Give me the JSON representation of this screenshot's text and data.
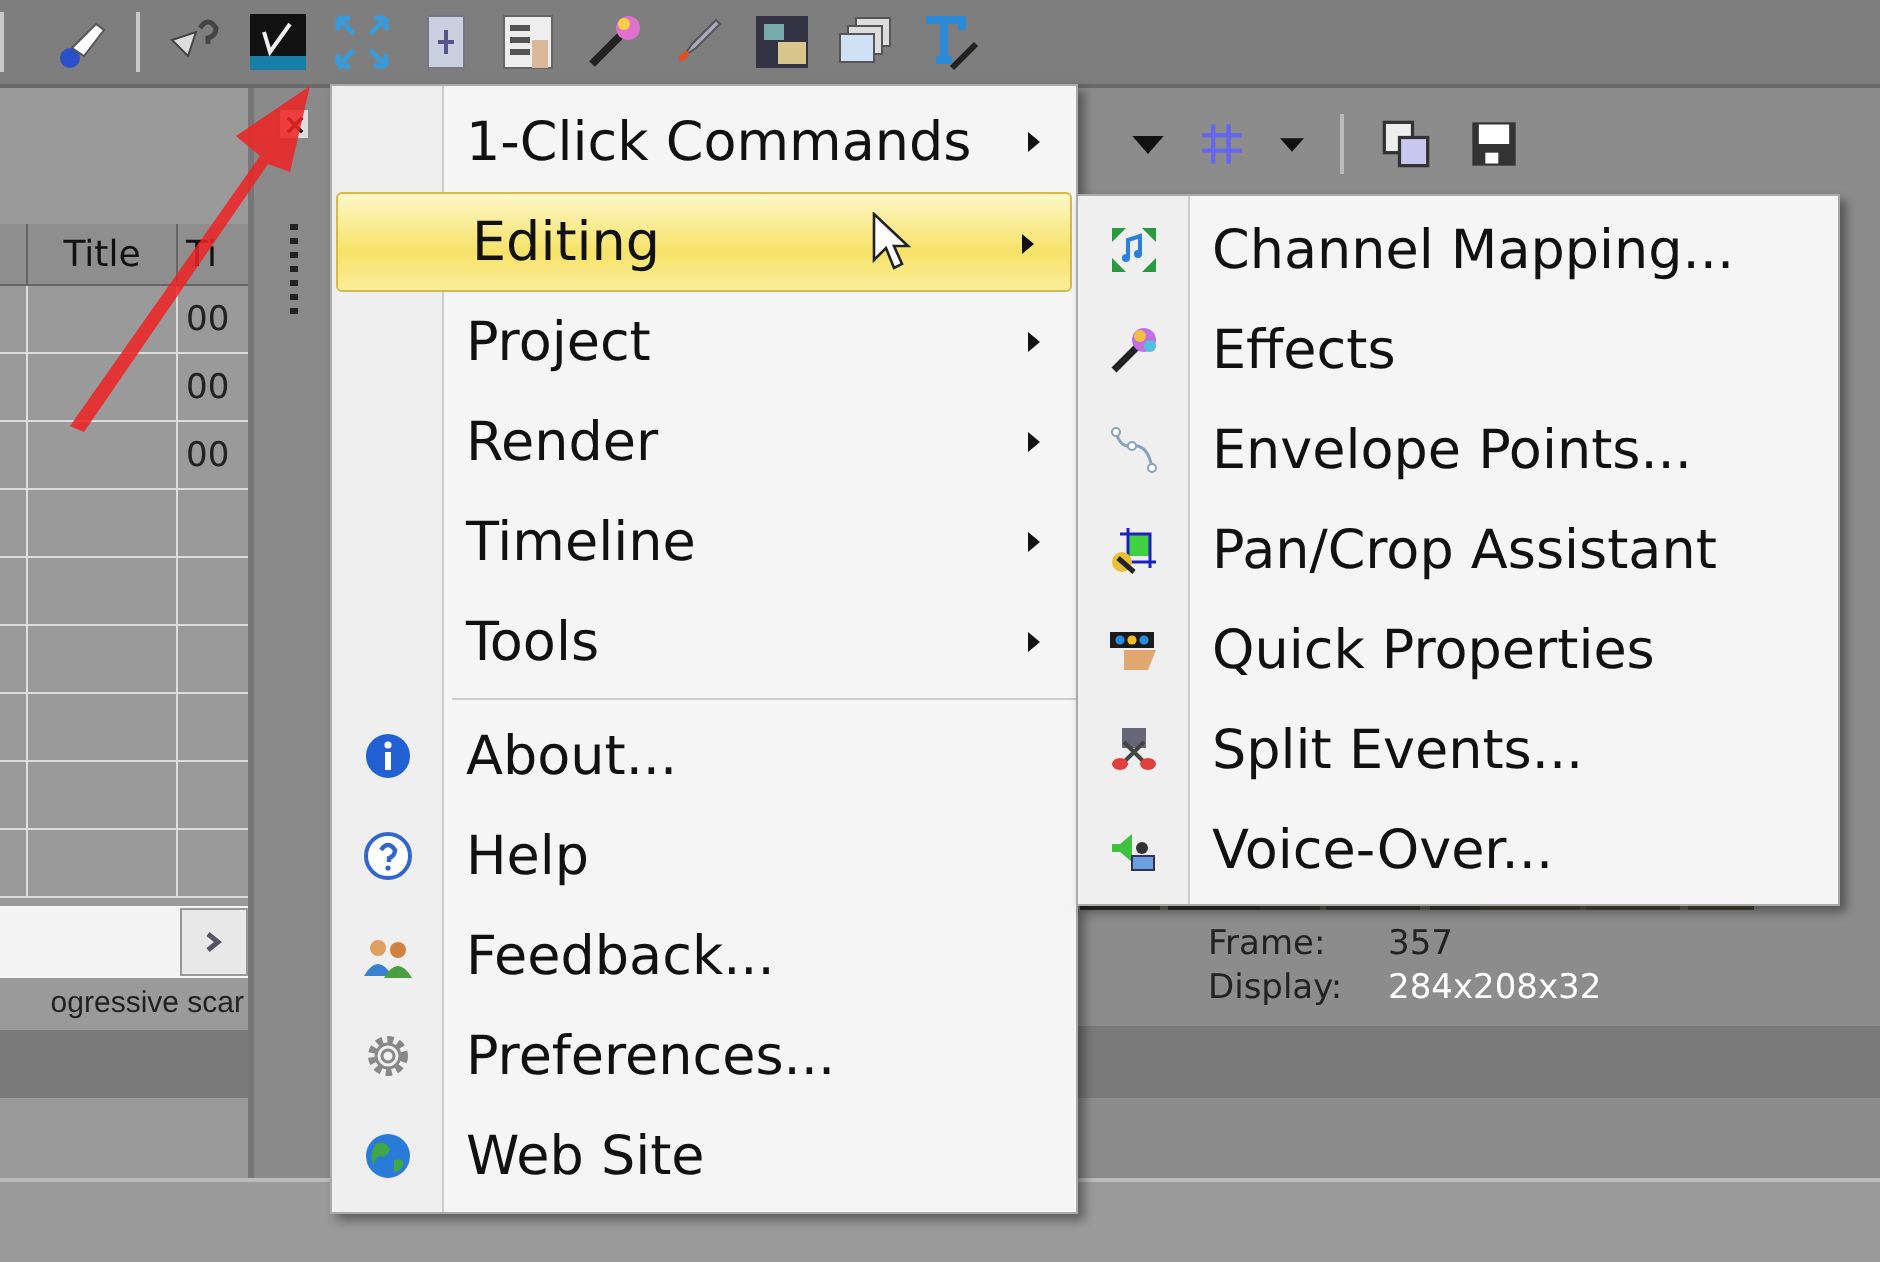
{
  "table": {
    "columns": [
      "Title",
      "Ti"
    ],
    "rows": [
      [
        "",
        "00"
      ],
      [
        "",
        "00"
      ],
      [
        "",
        "00"
      ],
      [
        "",
        ""
      ],
      [
        "",
        ""
      ],
      [
        "",
        ""
      ],
      [
        "",
        ""
      ],
      [
        "",
        ""
      ],
      [
        "",
        ""
      ]
    ]
  },
  "status_text": "ogressive scar",
  "preview": {
    "info": [
      {
        "label": "Frame:",
        "value": "357"
      },
      {
        "label": "Display:",
        "value": "284x208x32"
      }
    ]
  },
  "menu": {
    "items": [
      {
        "label": "1-Click Commands",
        "kind": "submenu",
        "selected": false
      },
      {
        "label": "Editing",
        "kind": "submenu",
        "selected": true
      },
      {
        "label": "Project",
        "kind": "submenu",
        "selected": false
      },
      {
        "label": "Render",
        "kind": "submenu",
        "selected": false
      },
      {
        "label": "Timeline",
        "kind": "submenu",
        "selected": false
      },
      {
        "label": "Tools",
        "kind": "submenu",
        "selected": false
      },
      {
        "kind": "separator"
      },
      {
        "label": "About...",
        "kind": "command",
        "selected": false
      },
      {
        "label": "Help",
        "kind": "command",
        "selected": false
      },
      {
        "label": "Feedback...",
        "kind": "command",
        "selected": false
      },
      {
        "label": "Preferences...",
        "kind": "command",
        "selected": false
      },
      {
        "label": "Web Site",
        "kind": "command",
        "selected": false
      }
    ]
  },
  "submenu": {
    "items": [
      {
        "label": "Channel Mapping..."
      },
      {
        "label": "Effects"
      },
      {
        "label": "Envelope Points..."
      },
      {
        "label": "Pan/Crop Assistant"
      },
      {
        "label": "Quick Properties"
      },
      {
        "label": "Split Events..."
      },
      {
        "label": "Voice-Over..."
      }
    ]
  }
}
